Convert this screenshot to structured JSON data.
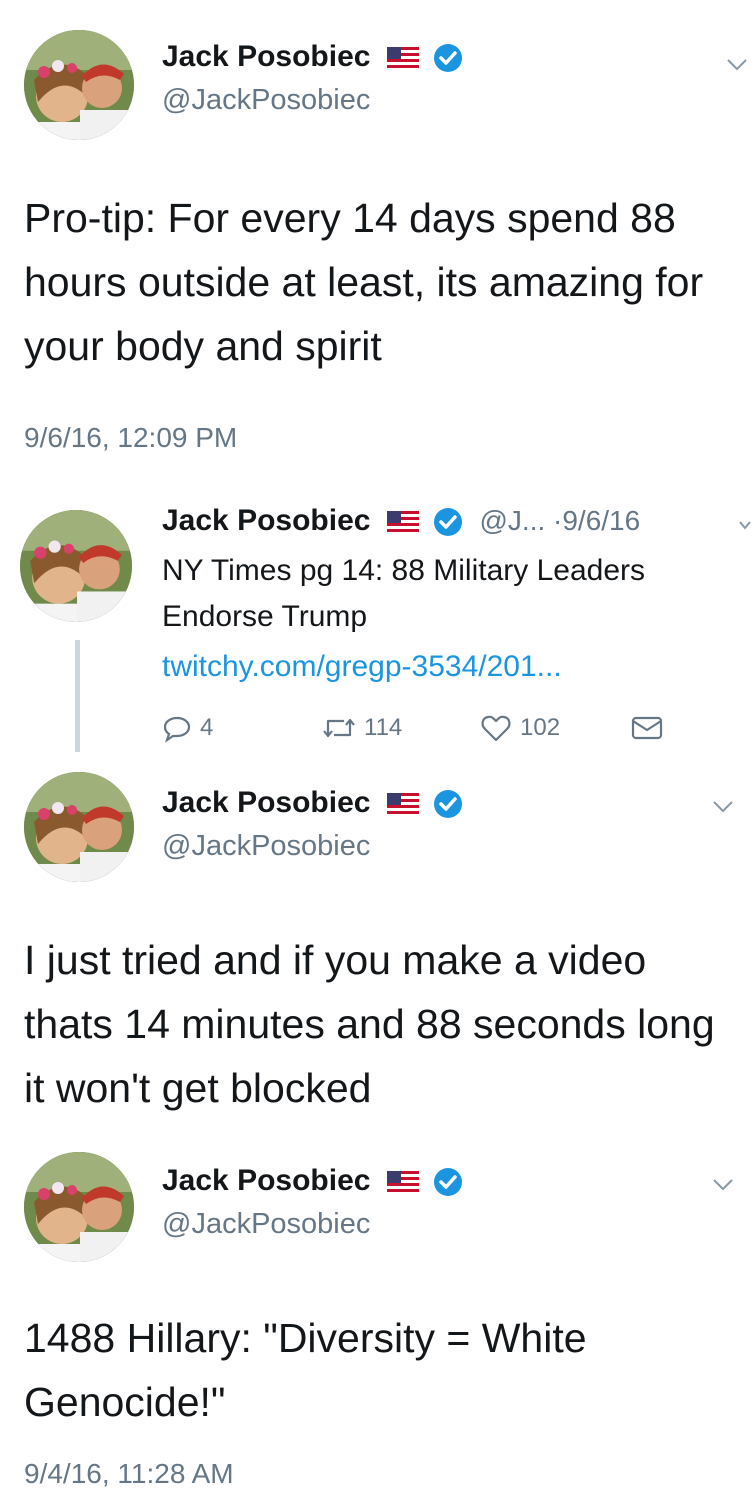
{
  "colors": {
    "accent": "#1b95e0",
    "muted": "#657786",
    "text": "#14171a"
  },
  "icons": {
    "verified": "verified-badge-icon",
    "flag": "us-flag-icon",
    "menu": "chevron-down-icon",
    "reply": "reply-icon",
    "retweet": "retweet-icon",
    "like": "heart-icon",
    "dm": "envelope-icon"
  },
  "tweet1": {
    "name": "Jack Posobiec",
    "handle": "@JackPosobiec",
    "text": "Pro-tip: For every 14 days spend 88 hours outside at least, its amazing for your body and spirit",
    "timestamp": "9/6/16, 12:09 PM"
  },
  "quoted": {
    "name": "Jack Posobiec",
    "meta": "@J... ·9/6/16",
    "text": "NY Times pg 14: 88 Military Leaders Endorse Trump",
    "link": "twitchy.com/gregp-3534/201...",
    "replies": "4",
    "retweets": "114",
    "likes": "102"
  },
  "tweet2": {
    "name": "Jack Posobiec",
    "handle": "@JackPosobiec",
    "text": "I just tried and if you make a video thats 14 minutes and 88 seconds long it won't get blocked"
  },
  "tweet3": {
    "name": "Jack Posobiec",
    "handle": "@JackPosobiec",
    "text": "1488 Hillary: \"Diversity = White Genocide!\"",
    "timestamp": "9/4/16, 11:28 AM"
  }
}
